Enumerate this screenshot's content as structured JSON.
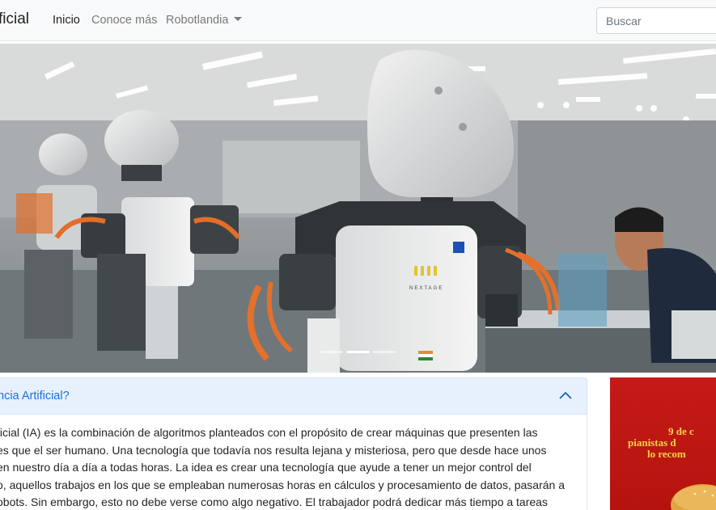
{
  "navbar": {
    "brand": "ficial",
    "links": [
      {
        "label": "Inicio",
        "active": true
      },
      {
        "label": "Conoce más",
        "active": false
      },
      {
        "label": "Robotlandia",
        "active": false
      }
    ],
    "search_placeholder": "Buscar"
  },
  "carousel": {
    "image_labels": [
      "NEXTAGE"
    ],
    "active_slide": 2,
    "slide_count": 3
  },
  "accordion": {
    "title": "ncia Artificial?",
    "expanded": true,
    "body_lines": [
      "ficial (IA) es la combinación de algoritmos planteados con el propósito de crear máquinas que presenten las",
      "es que el ser humano. Una tecnología que todavía nos resulta lejana y misteriosa, pero que desde hace unos",
      " en nuestro día a día a todas horas. La idea es crear una tecnología que ayude a tener un mejor control del",
      "o, aquellos trabajos en los que se empleaban numerosas horas en cálculos y procesamiento de datos, pasarán a",
      "obots. Sin embargo, esto no debe verse como algo negativo. El trabajador podrá dedicar más tiempo a tareas"
    ]
  },
  "ad": {
    "lines": [
      "9 de c",
      "pianistas d",
      "lo recom"
    ]
  },
  "colors": {
    "navbar_bg": "#f8f9fa",
    "accordion_header_bg": "#e7f1fd",
    "accordion_title": "#1a6fe0",
    "ad_bg": "#c51a17",
    "ad_text": "#f6d448"
  }
}
